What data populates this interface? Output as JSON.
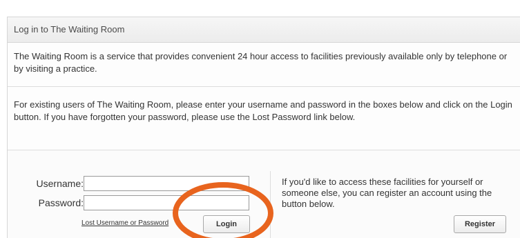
{
  "panel": {
    "title": "Log in to The Waiting Room"
  },
  "intro": {
    "text": "The Waiting Room is a service that provides convenient 24 hour access to facilities previously available only by telephone or by visiting a practice."
  },
  "instructions": {
    "text": "For existing users of The Waiting Room, please enter your username and password in the boxes below and click on the Login button. If you have forgotten your password, please use the Lost Password link below."
  },
  "login_form": {
    "username_label": "Username:",
    "username_value": "",
    "password_label": "Password:",
    "password_value": "",
    "lost_link": "Lost Username or Password",
    "login_button": "Login"
  },
  "register": {
    "text": "If you'd like to access these facilities for yourself or someone else, you can register an account using the button below.",
    "button": "Register"
  },
  "annotation": {
    "color": "#e8641e"
  }
}
